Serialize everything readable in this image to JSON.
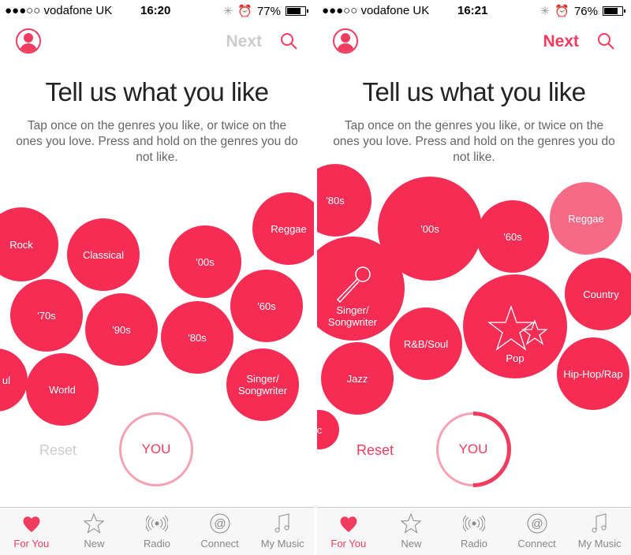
{
  "colors": {
    "accent": "#f23c5f",
    "bubble": "#f52d55",
    "bubble_light": "#f76a85",
    "inactive": "#cccccc"
  },
  "screens": [
    {
      "status": {
        "carrier": "●●●○○ vodafone UK",
        "time": "16:20",
        "battery": "77%",
        "battery_level": 0.77
      },
      "header": {
        "next_label": "Next",
        "next_enabled": false
      },
      "title": "Tell us what you like",
      "description": "Tap once on the genres you like, or twice on the ones you love. Press and hold on the genres you do not like.",
      "genres": [
        "Rock",
        "Classical",
        "'00s",
        "Reggae",
        "'70s",
        "'90s",
        "'80s",
        "'60s",
        "ul",
        "World",
        "Singer/ Songwriter"
      ],
      "reset_label": "Reset",
      "you_label": "YOU",
      "progress": 0
    },
    {
      "status": {
        "carrier": "●●●○○ vodafone UK",
        "time": "16:21",
        "battery": "76%",
        "battery_level": 0.76
      },
      "header": {
        "next_label": "Next",
        "next_enabled": true
      },
      "title": "Tell us what you like",
      "description": "Tap once on the genres you like, or twice on the ones you love. Press and hold on the genres you do not like.",
      "genres": [
        "'80s",
        "'00s",
        "'60s",
        "Reggae",
        "Singer/ Songwriter",
        "R&B/Soul",
        "Pop",
        "Country",
        "Hip-Hop/Rap",
        "Jazz",
        "c"
      ],
      "reset_label": "Reset",
      "you_label": "YOU",
      "progress": 0.5
    }
  ],
  "tabs": [
    {
      "label": "For You",
      "icon": "heart-icon",
      "active": true
    },
    {
      "label": "New",
      "icon": "star-icon"
    },
    {
      "label": "Radio",
      "icon": "radio-icon"
    },
    {
      "label": "Connect",
      "icon": "at-icon"
    },
    {
      "label": "My Music",
      "icon": "music-note-icon"
    }
  ]
}
